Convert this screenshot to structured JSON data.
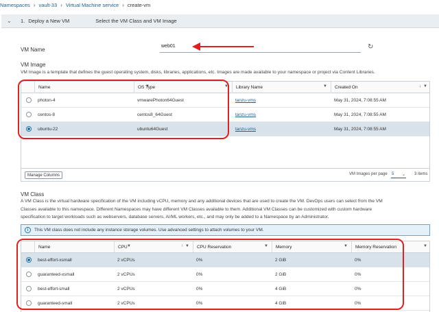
{
  "breadcrumb": [
    "Namespaces",
    "vault-33",
    "Virtual Machine service",
    "create-vm"
  ],
  "step": {
    "chevron": "⌄",
    "number": "1.",
    "title": "Deploy a New VM",
    "subtitle": "Select the VM Class and VM Image"
  },
  "vm_name": {
    "label": "VM Name",
    "value": "web01"
  },
  "vm_image": {
    "heading": "VM Image",
    "description": "VM Image is a template that defines the guest operating system, disks, libraries, applications, etc. Images are made available to your namespace or project via Content Libraries.",
    "columns": [
      "Name",
      "OS Type",
      "Library Name",
      "Created On"
    ],
    "rows": [
      {
        "name": "photon-4",
        "os_type": "vmwarePhoton64Guest",
        "library": "tanzu-vms",
        "created": "May 31, 2024, 7:08:55 AM",
        "selected": false
      },
      {
        "name": "centos-8",
        "os_type": "centos8_64Guest",
        "library": "tanzu-vms",
        "created": "May 31, 2024, 7:08:55 AM",
        "selected": false
      },
      {
        "name": "ubuntu-22",
        "os_type": "ubuntu64Guest",
        "library": "tanzu-vms",
        "created": "May 31, 2024, 7:08:55 AM",
        "selected": true
      }
    ],
    "footer": {
      "manage_columns": "Manage Columns",
      "per_page_label": "VM Images per page",
      "per_page": "5",
      "item_count": "3 items"
    }
  },
  "vm_class": {
    "heading": "VM Class",
    "description_lines": [
      "A VM Class is the virtual hardware specification of the VM including vCPU, memory and any additional devices that are used to create the VM. DevOps users can select from the VM",
      "Classes available to this namespace. Different Namespaces may have different VM Classes available to them. Additional VM Classes can be customized with custom hardware",
      "specification to target workloads such as webservers, database servers, AI/ML workers, etc., and may only be added to a Namespace by an Administrator."
    ],
    "info": "This VM class does not include any instance storage volumes. Use advanced settings to attach volumes to your VM.",
    "columns": [
      "Name",
      "CPU",
      "CPU Reservation",
      "Memory",
      "Memory Reservation"
    ],
    "rows": [
      {
        "name": "best-effort-xsmall",
        "cpu": "2 vCPUs",
        "cpu_res": "0%",
        "memory": "2 GiB",
        "mem_res": "0%",
        "selected": true
      },
      {
        "name": "guaranteed-xsmall",
        "cpu": "2 vCPUs",
        "cpu_res": "0%",
        "memory": "2 GiB",
        "mem_res": "0%",
        "selected": false
      },
      {
        "name": "best-effort-small",
        "cpu": "2 vCPUs",
        "cpu_res": "0%",
        "memory": "4 GiB",
        "mem_res": "0%",
        "selected": false
      },
      {
        "name": "guaranteed-small",
        "cpu": "2 vCPUs",
        "cpu_res": "0%",
        "memory": "4 GiB",
        "mem_res": "0%",
        "selected": false
      }
    ]
  },
  "colors": {
    "selected_row": "#d7e2ea",
    "link": "#1d5e8c",
    "annotation": "#e01f1f",
    "info_bg": "#e4f1fb"
  }
}
